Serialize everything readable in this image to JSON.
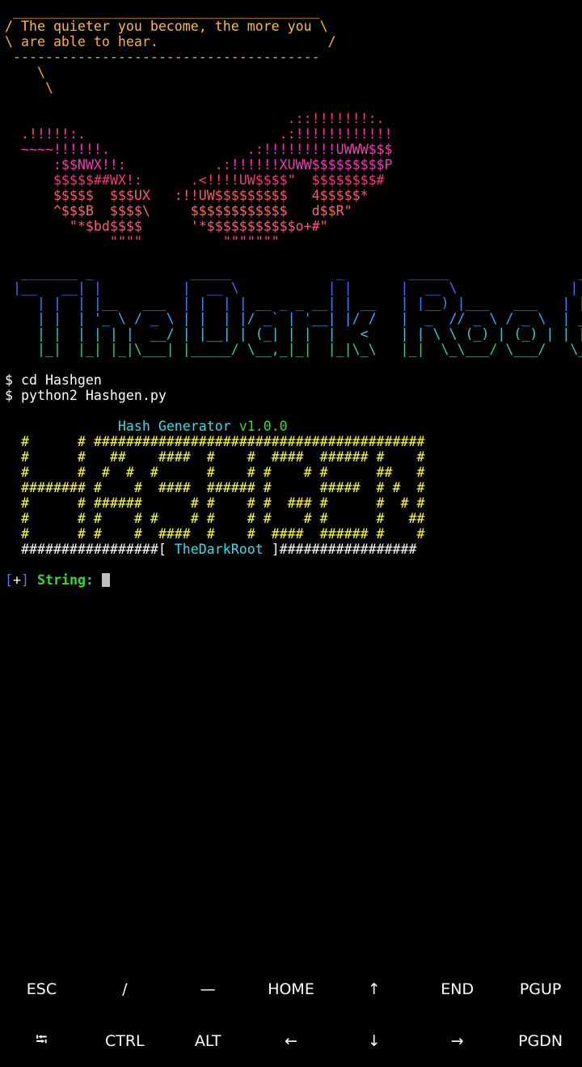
{
  "terminal": {
    "lines": [
      [
        {
          "t": " ______________________________________",
          "c": "#ffbb33"
        }
      ],
      [
        {
          "t": "/ The quieter you become, the more you \\",
          "c": "#ffbb33"
        }
      ],
      [
        {
          "t": "\\ are able to hear.                     /",
          "c": "#ffb033"
        }
      ],
      [
        {
          "t": " --------------------------------------",
          "c": "#ffa033"
        }
      ],
      [
        {
          "t": "    \\",
          "c": "#ffa033"
        }
      ],
      [
        {
          "t": "     \\",
          "c": "#ff9a33"
        }
      ],
      [
        {
          "t": "",
          "c": "#fff"
        }
      ],
      [
        {
          "t": "                                   .::!!!!!!!:.",
          "c": "#ff3399"
        }
      ],
      [
        {
          "t": "  .!!!!!:.                        .:!!!!!!!!!!!!",
          "c": "#ff33aa"
        }
      ],
      [
        {
          "t": "  ~~~~!!!!!!.                 .:!!!!!!!!!UWWW$$$",
          "c": "#ff33bb"
        }
      ],
      [
        {
          "t": "      :$$NWX!!:           .:!!!!!!XUWW$$$$$$$$$P",
          "c": "#ff33bb"
        }
      ],
      [
        {
          "t": "      $$$$$##WX!:      .<!!!!UW$$$$\"  $$$$$$$$#",
          "c": "#ff3377"
        }
      ],
      [
        {
          "t": "      $$$$$  $$$UX   :!!UW$$$$$$$$$   4$$$$$*",
          "c": "#ff5566"
        }
      ],
      [
        {
          "t": "      ^$$$B  $$$$\\     $$$$$$$$$$$$   d$$R\"",
          "c": "#ff6666"
        }
      ],
      [
        {
          "t": "        \"*$bd$$$$      '*$$$$$$$$$$$o+#\"",
          "c": "#ff5588"
        }
      ],
      [
        {
          "t": "             \"\"\"\"          \"\"\"\"\"\"\"",
          "c": "#ff3399"
        }
      ],
      [
        {
          "t": "",
          "c": "#fff"
        }
      ],
      [
        {
          "t": "  _______ _            _____             _        _____                _",
          "c": "#8844ff"
        }
      ],
      [
        {
          "t": " |__   __| |          |  __ \\           | |      |  __ \\              | |",
          "c": "#5566ff"
        }
      ],
      [
        {
          "t": "    | |  | |__   ___  | |  | | __ _ _ __| | __   | |__) |___   ___   | |_",
          "c": "#3388ff"
        }
      ],
      [
        {
          "t": "    | |  | '_ \\ / _ \\ | |  | |/ _` | '__| |/ /   |  _  // _ \\ / _ \\  | __|",
          "c": "#33aaff"
        }
      ],
      [
        {
          "t": "    | |  | | | |  __/ | |__| | (_| | |  |   <    | | \\ \\ (_) | (_) | | |_",
          "c": "#33ccdd"
        }
      ],
      [
        {
          "t": "    |_|  |_| |_|\\___| |_____/ \\__,_|_|  |_|\\_\\   |_|  \\_\\___/ \\___/   \\__|",
          "c": "#33cc99"
        }
      ],
      [
        {
          "t": "",
          "c": "#fff"
        }
      ],
      [
        {
          "t": "$ cd Hashgen",
          "c": "#ffffff"
        }
      ],
      [
        {
          "t": "$ python2 Hashgen.py",
          "c": "#ffffff"
        }
      ],
      [
        {
          "t": "",
          "c": "#fff"
        }
      ],
      [
        {
          "t": "              ",
          "c": "#fff"
        },
        {
          "t": "Hash Generator ",
          "c": "#22e5ee"
        },
        {
          "t": "v1.0.0",
          "c": "#33dd33"
        }
      ],
      [
        {
          "t": "  #      # #########################################",
          "c": "#ffff33"
        }
      ],
      [
        {
          "t": "  #      #   ##    ####  #    #  ####  ###### #    #",
          "c": "#ffff33"
        }
      ],
      [
        {
          "t": "  #      #  #  #  #      #    # #    # #      ##   #",
          "c": "#ffff33"
        }
      ],
      [
        {
          "t": "  ######## #    #  ####  ###### #      #####  # #  #",
          "c": "#ffff33"
        }
      ],
      [
        {
          "t": "  #      # ######      # #    # #  ### #      #  # #",
          "c": "#ffff33"
        }
      ],
      [
        {
          "t": "  #      # #    # #    # #    # #    # #      #   ##",
          "c": "#ffff33"
        }
      ],
      [
        {
          "t": "  #      # #    #  ####  #    #  ####  ###### #    #",
          "c": "#ffff33"
        }
      ],
      [
        {
          "t": "  #################[ ",
          "c": "#ffffff"
        },
        {
          "t": "TheDarkRoot",
          "c": "#22e5ee"
        },
        {
          "t": " ]#################",
          "c": "#ffffff"
        }
      ],
      [
        {
          "t": "",
          "c": "#fff"
        }
      ]
    ],
    "prompt": {
      "open": "[",
      "plus": "+",
      "close": "]",
      "label": " String: "
    }
  },
  "colors": {
    "prompt_bracket": "#5577ff",
    "prompt_plus": "#ffffff",
    "prompt_label": "#33dd33"
  },
  "extra_keys": {
    "row1": [
      "ESC",
      "/",
      "—",
      "HOME",
      "↑",
      "END",
      "PGUP"
    ],
    "row2": [
      "⭾",
      "CTRL",
      "ALT",
      "←",
      "↓",
      "→",
      "PGDN"
    ]
  }
}
